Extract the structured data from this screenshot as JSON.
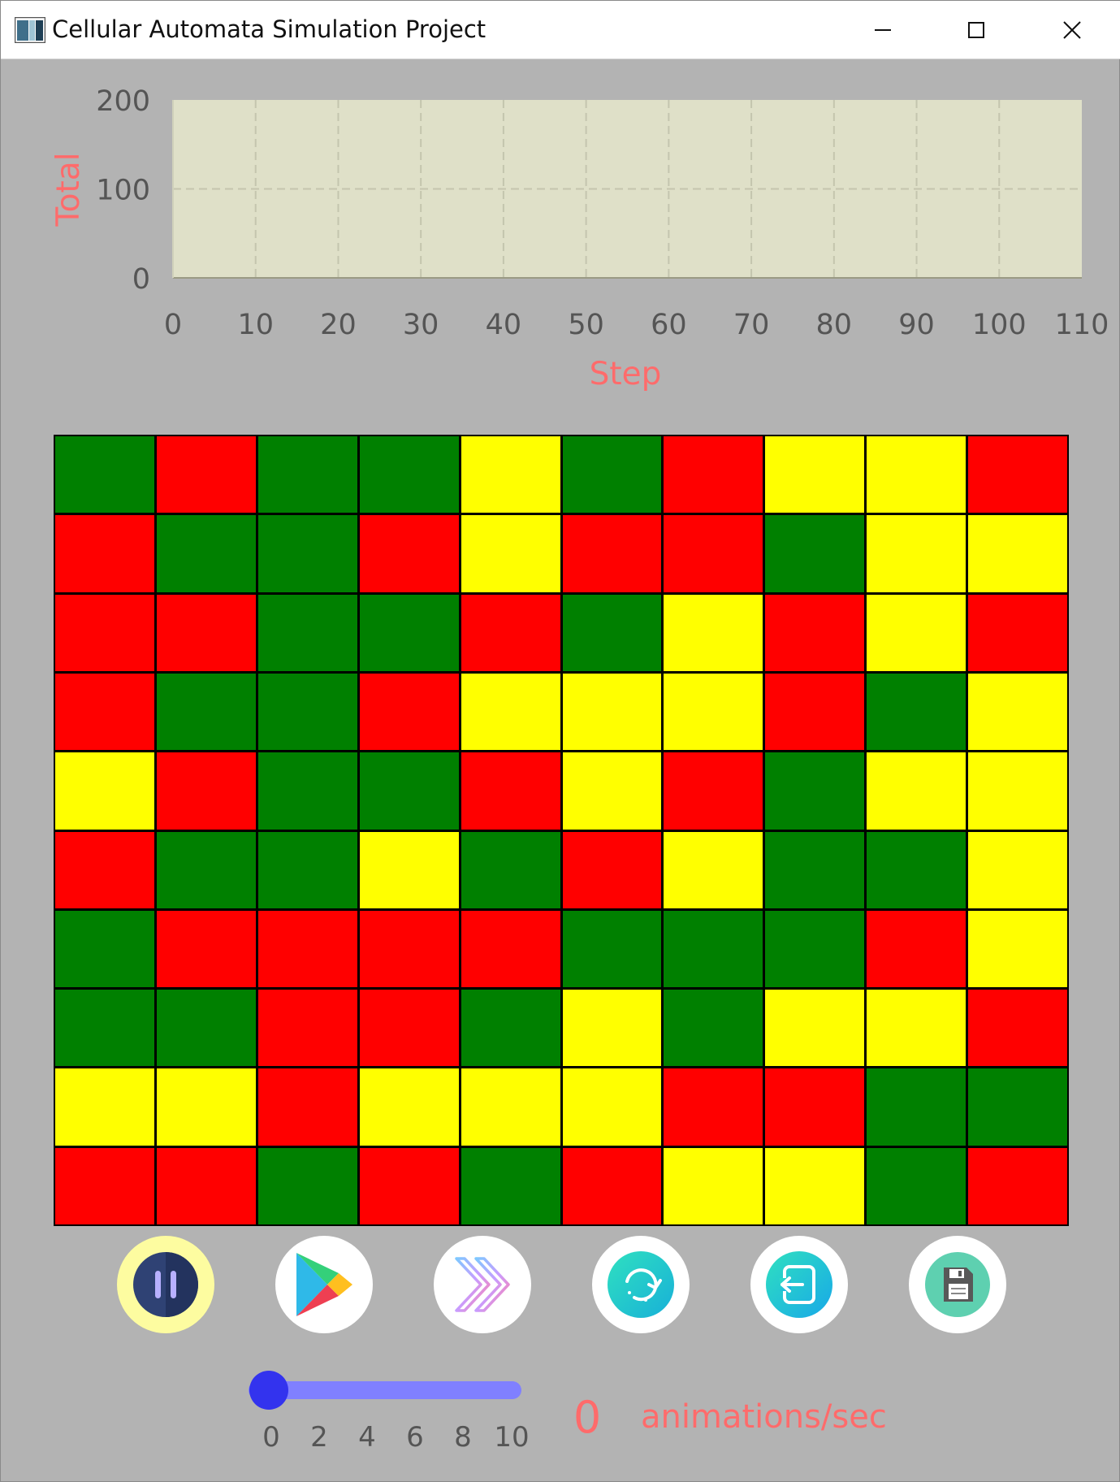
{
  "window": {
    "title": "Cellular Automata Simulation Project",
    "controls": [
      "minimize",
      "maximize",
      "close"
    ]
  },
  "chart_data": {
    "type": "line",
    "title": "",
    "xlabel": "Step",
    "ylabel": "Total",
    "xlim": [
      0,
      110
    ],
    "ylim": [
      0,
      200
    ],
    "x_ticks": [
      "0",
      "10",
      "20",
      "30",
      "40",
      "50",
      "60",
      "70",
      "80",
      "90",
      "100",
      "110"
    ],
    "y_ticks": [
      "0",
      "100",
      "200"
    ],
    "grid": true,
    "series": [],
    "colors": {
      "plot_background": "#dfe0c8",
      "label": "#ff6b6b",
      "tick": "#555555"
    }
  },
  "grid": {
    "rows": 10,
    "cols": 10,
    "palette": {
      "G": "#008000",
      "R": "#ff0000",
      "Y": "#ffff00"
    },
    "cells": [
      "GRGGYGRYYR",
      "RGGRYRRGYY",
      "RRGGRGYRYR",
      "RGGRYYYRGY",
      "YRGGRYRGYY",
      "RGGYGRYGGY",
      "GRRRRGGGRY",
      "GGRRGYGYYR",
      "YYRYYYRRGG",
      "RRGRGRYYGR"
    ]
  },
  "controls": {
    "buttons": [
      {
        "name": "pause",
        "icon": "pause-icon",
        "active": true
      },
      {
        "name": "play",
        "icon": "play-icon",
        "active": false
      },
      {
        "name": "step-forward",
        "icon": "fast-forward-icon",
        "active": false
      },
      {
        "name": "reset",
        "icon": "refresh-icon",
        "active": false
      },
      {
        "name": "exit",
        "icon": "exit-icon",
        "active": false
      },
      {
        "name": "save",
        "icon": "save-icon",
        "active": false
      }
    ],
    "speed": {
      "min": 0,
      "max": 10,
      "value": 0,
      "ticks": [
        "0",
        "2",
        "4",
        "6",
        "8",
        "10"
      ],
      "display_value": "0",
      "unit_label": "animations/sec"
    }
  }
}
